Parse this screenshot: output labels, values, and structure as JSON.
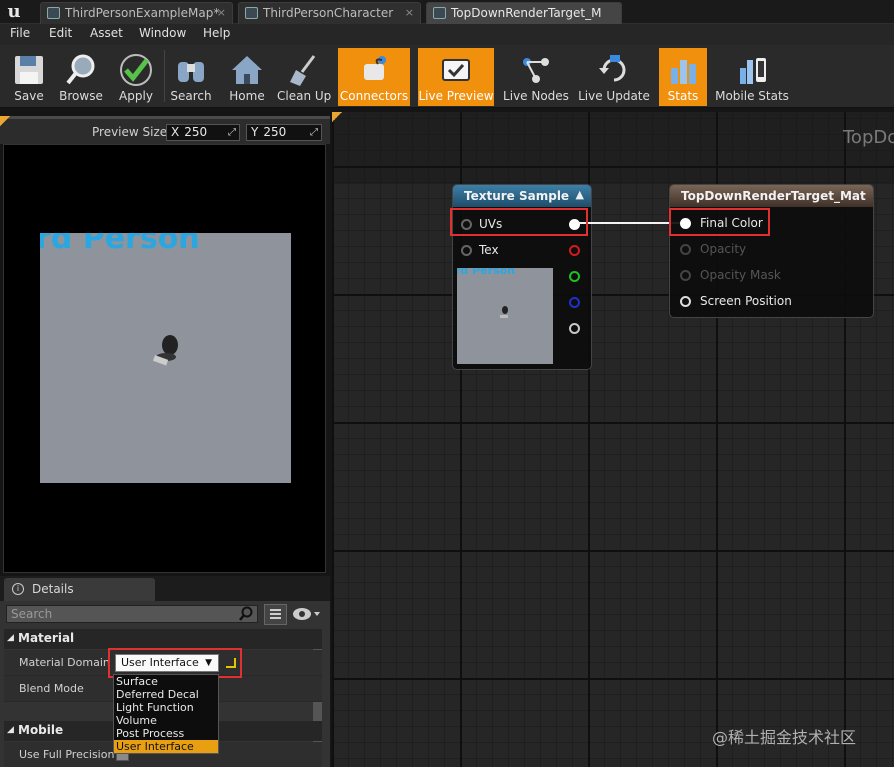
{
  "tabs": [
    {
      "label": "ThirdPersonExampleMap*"
    },
    {
      "label": "ThirdPersonCharacter"
    },
    {
      "label": "TopDownRenderTarget_M"
    }
  ],
  "tab_close_glyph": "×",
  "app_logo": "u",
  "menu": [
    "File",
    "Edit",
    "Asset",
    "Window",
    "Help"
  ],
  "toolbar": [
    {
      "label": "Save",
      "icon": "floppy-disk-icon",
      "active": false
    },
    {
      "label": "Browse",
      "icon": "magnifier-icon",
      "active": false
    },
    {
      "label": "Apply",
      "icon": "checkmark-icon",
      "active": false
    },
    {
      "label": "Search",
      "icon": "binoculars-icon",
      "active": false
    },
    {
      "label": "Home",
      "icon": "house-icon",
      "active": false
    },
    {
      "label": "Clean Up",
      "icon": "broom-icon",
      "active": false
    },
    {
      "label": "Connectors",
      "icon": "connector-icon",
      "active": true
    },
    {
      "label": "Live Preview",
      "icon": "monitor-icon",
      "active": true
    },
    {
      "label": "Live Nodes",
      "icon": "nodes-icon",
      "active": false
    },
    {
      "label": "Live Update",
      "icon": "refresh-icon",
      "active": false
    },
    {
      "label": "Stats",
      "icon": "bar-chart-icon",
      "active": true
    },
    {
      "label": "Mobile Stats",
      "icon": "mobile-chart-icon",
      "active": false
    }
  ],
  "preview": {
    "size_label": "Preview Size",
    "x_axis": "X",
    "x_value": "250",
    "y_axis": "Y",
    "y_value": "250",
    "render_text": "rd Person"
  },
  "details": {
    "tab_label": "Details",
    "search_placeholder": "Search",
    "material_section": "Material",
    "mobile_section": "Mobile",
    "material_domain_label": "Material Domain",
    "material_domain_value": "User Interface",
    "blend_mode_label": "Blend Mode",
    "full_precision_label": "Use Full Precision",
    "domain_options": [
      "Surface",
      "Deferred Decal",
      "Light Function",
      "Volume",
      "Post Process",
      "User Interface"
    ],
    "selected_option": "User Interface"
  },
  "graph": {
    "title": "TopDo",
    "texture_node": {
      "title": "Texture Sample",
      "inputs": [
        "UVs",
        "Tex"
      ],
      "thumb_text": "rd Person",
      "output_colors": [
        "#ffffff",
        "#d21c1c",
        "#20c020",
        "#2030c8",
        "#c8c8c8"
      ]
    },
    "material_node": {
      "title": "TopDownRenderTarget_Mat",
      "inputs": [
        {
          "label": "Final Color",
          "enabled": true
        },
        {
          "label": "Opacity",
          "enabled": false
        },
        {
          "label": "Opacity Mask",
          "enabled": false
        },
        {
          "label": "Screen Position",
          "enabled": true
        }
      ]
    }
  },
  "watermark": "@稀土掘金技术社区",
  "colors": {
    "accent_orange": "#f0900d",
    "highlight_red": "#e03030",
    "texture_header": "#3d7fa6"
  }
}
